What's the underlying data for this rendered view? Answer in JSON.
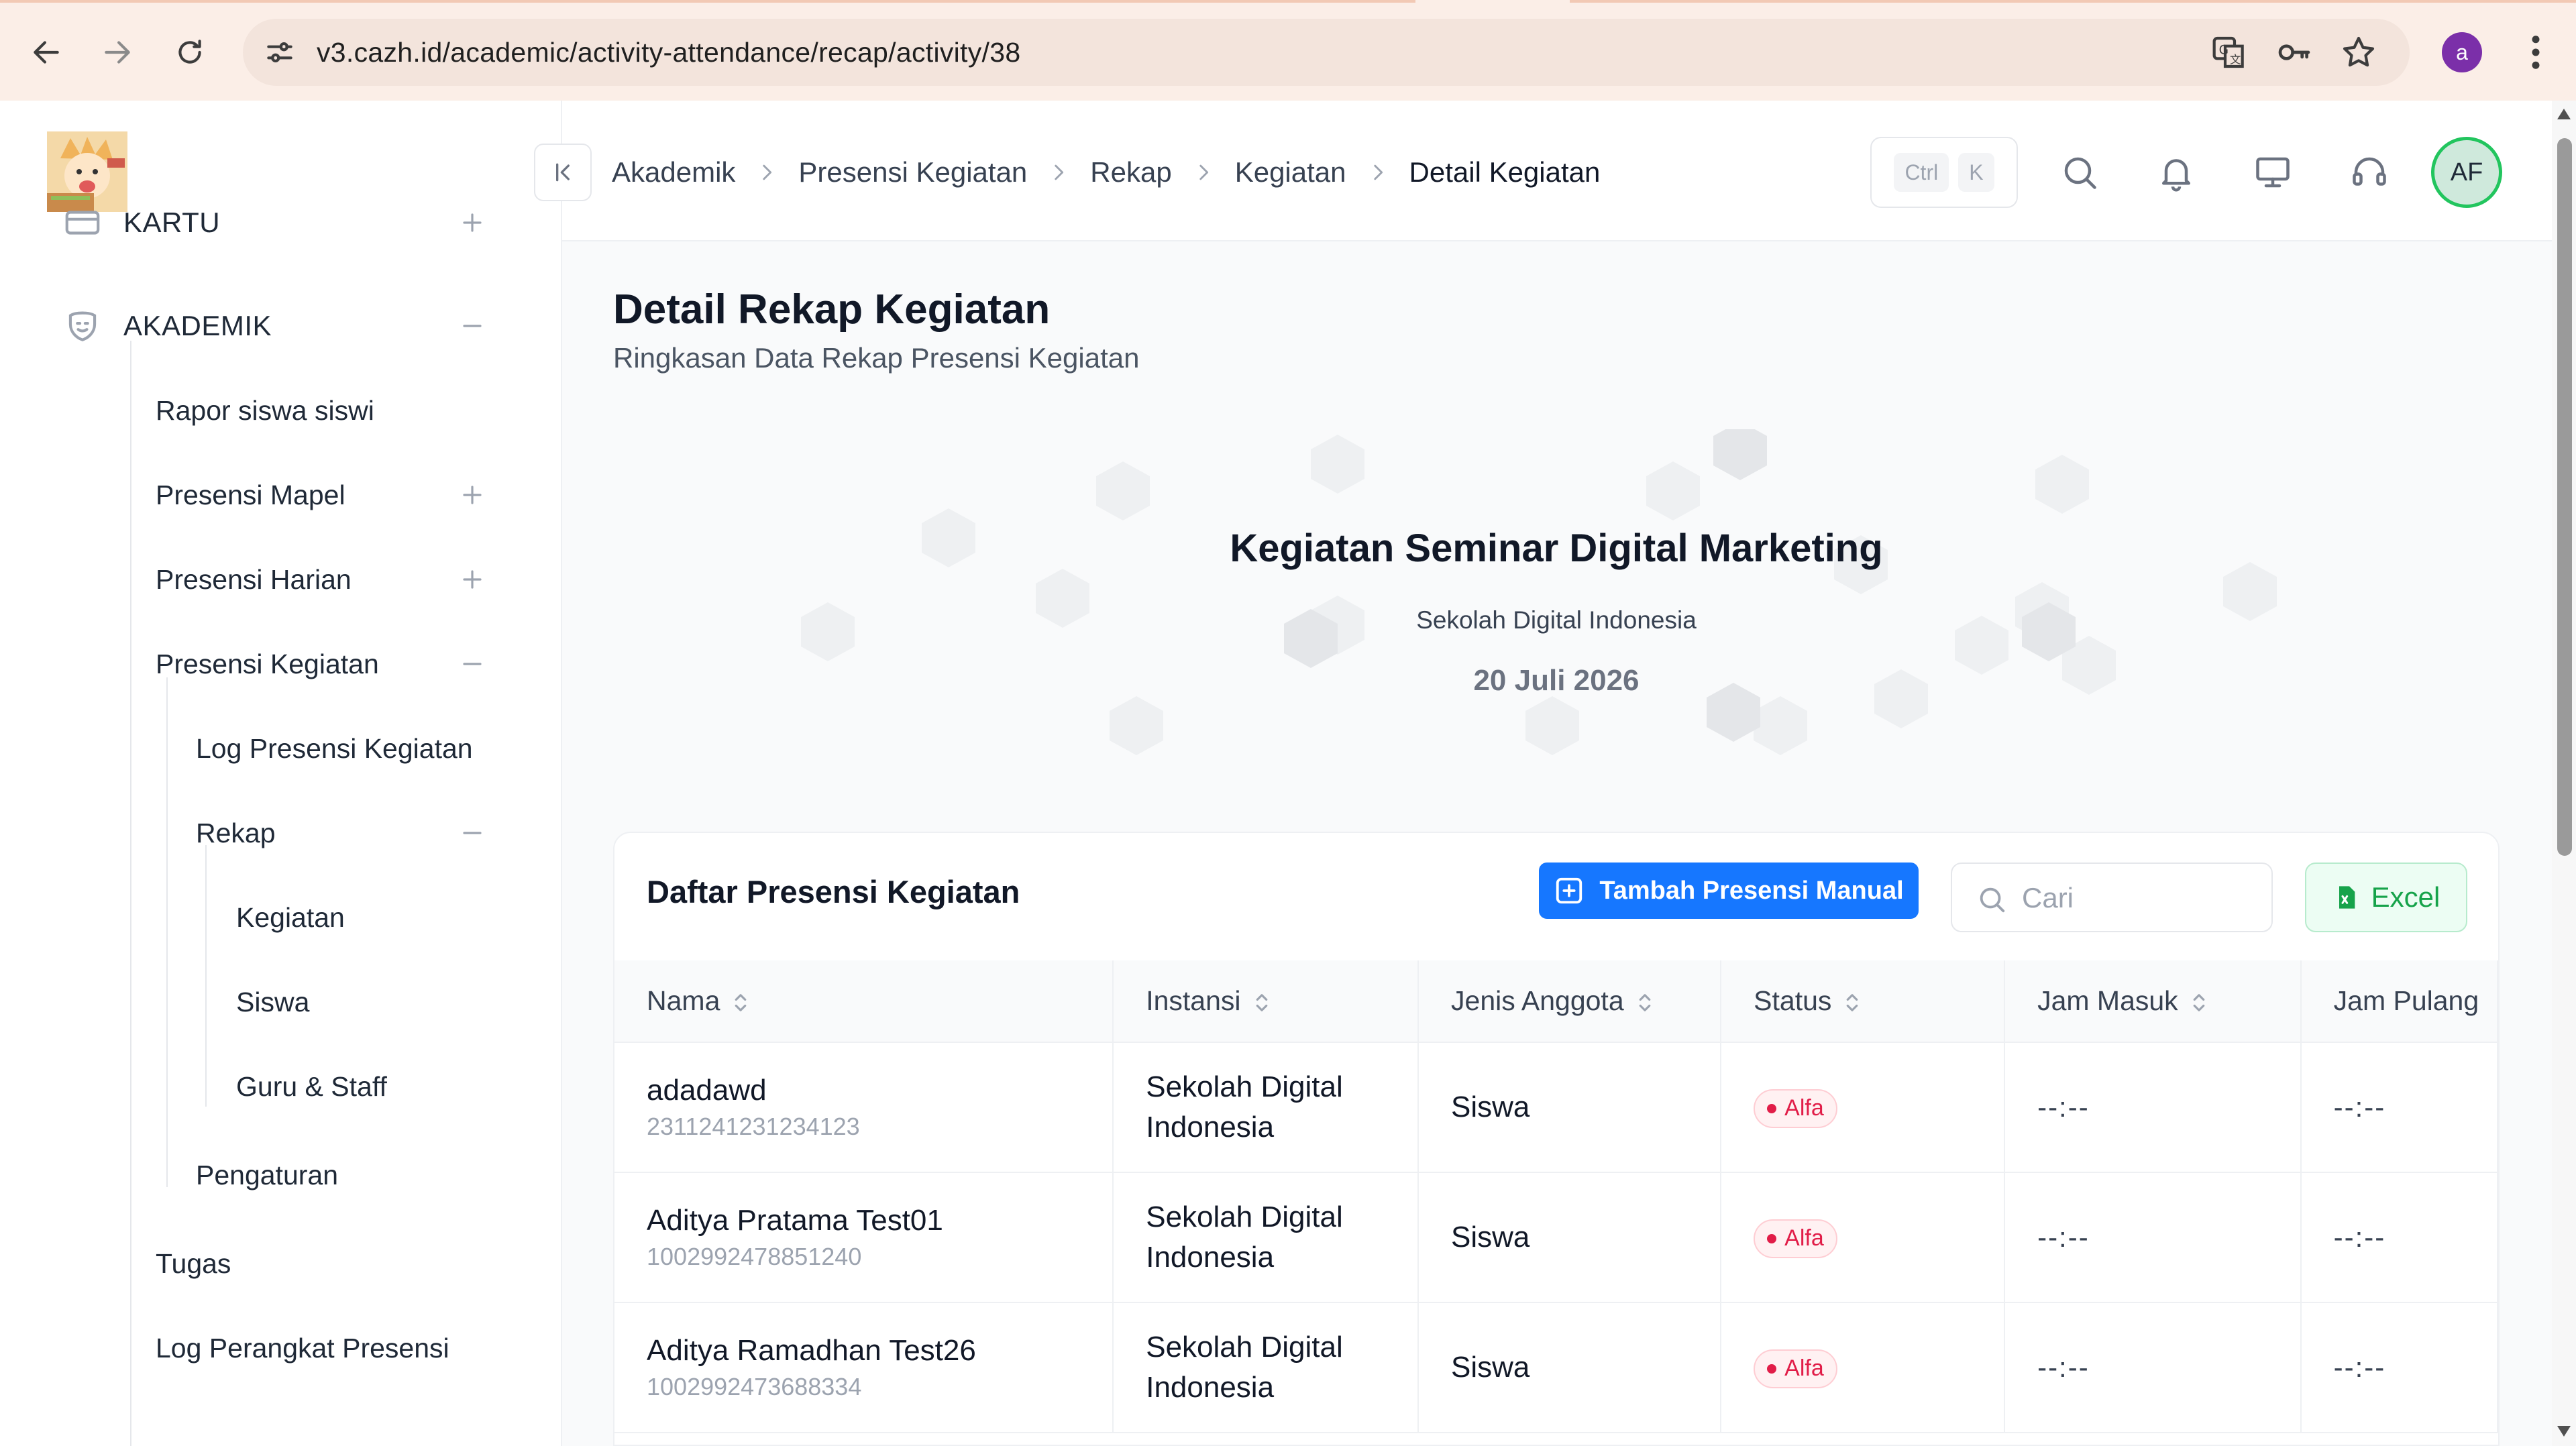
{
  "browser": {
    "url": "v3.cazh.id/academic/activity-attendance/recap/activity/38",
    "profile_initial": "a",
    "icons": [
      "back-arrow-icon",
      "forward-arrow-icon",
      "reload-icon",
      "site-settings-icon",
      "translate-icon",
      "password-key-icon",
      "bookmark-star-icon",
      "kebab-menu-icon"
    ]
  },
  "sidebar": {
    "items": [
      {
        "label": "KARTU",
        "sign": "plus",
        "level": 0
      },
      {
        "label": "AKADEMIK",
        "sign": "minus",
        "level": 0
      },
      {
        "label": "Rapor siswa siswi",
        "sign": "",
        "level": 1
      },
      {
        "label": "Presensi Mapel",
        "sign": "plus",
        "level": 1
      },
      {
        "label": "Presensi Harian",
        "sign": "plus",
        "level": 1
      },
      {
        "label": "Presensi Kegiatan",
        "sign": "minus",
        "level": 1
      },
      {
        "label": "Log Presensi Kegiatan",
        "sign": "",
        "level": 2
      },
      {
        "label": "Rekap",
        "sign": "minus",
        "level": 2
      },
      {
        "label": "Kegiatan",
        "sign": "",
        "level": 3
      },
      {
        "label": "Siswa",
        "sign": "",
        "level": 3
      },
      {
        "label": "Guru & Staff",
        "sign": "",
        "level": 3
      },
      {
        "label": "Pengaturan",
        "sign": "",
        "level": 2
      },
      {
        "label": "Tugas",
        "sign": "",
        "level": 1
      },
      {
        "label": "Log Perangkat Presensi",
        "sign": "",
        "level": 1
      }
    ]
  },
  "header": {
    "breadcrumbs": [
      "Akademik",
      "Presensi Kegiatan",
      "Rekap",
      "Kegiatan",
      "Detail Kegiatan"
    ],
    "shortcut": {
      "key1": "Ctrl",
      "key2": "K"
    },
    "avatar_initials": "AF"
  },
  "page": {
    "title": "Detail Rekap Kegiatan",
    "subtitle": "Ringkasan Data Rekap Presensi Kegiatan"
  },
  "hero": {
    "activity_name": "Kegiatan Seminar Digital Marketing",
    "school": "Sekolah Digital Indonesia",
    "date": "20 Juli 2026"
  },
  "list": {
    "title": "Daftar Presensi Kegiatan",
    "add_button": "Tambah Presensi Manual",
    "search_placeholder": "Cari",
    "excel_button": "Excel",
    "columns": [
      "Nama",
      "Instansi",
      "Jenis Anggota",
      "Status",
      "Jam Masuk",
      "Jam Pulang"
    ],
    "rows": [
      {
        "name": "adadawd",
        "id": "2311241231234123",
        "instansi": "Sekolah Digital Indonesia",
        "jenis": "Siswa",
        "status": "Alfa",
        "jam_masuk": "--:--",
        "jam_pulang": "--:--"
      },
      {
        "name": "Aditya Pratama Test01",
        "id": "1002992478851240",
        "instansi": "Sekolah Digital Indonesia",
        "jenis": "Siswa",
        "status": "Alfa",
        "jam_masuk": "--:--",
        "jam_pulang": "--:--"
      },
      {
        "name": "Aditya Ramadhan Test26",
        "id": "1002992473688334",
        "instansi": "Sekolah Digital Indonesia",
        "jenis": "Siswa",
        "status": "Alfa",
        "jam_masuk": "--:--",
        "jam_pulang": "--:--"
      }
    ]
  },
  "colors": {
    "primary": "#1677ff",
    "excel_green": "#16a34a",
    "status_alfa": "#e11d48",
    "avatar_ring": "#22c55e",
    "chrome_bg": "#fbeee7"
  }
}
